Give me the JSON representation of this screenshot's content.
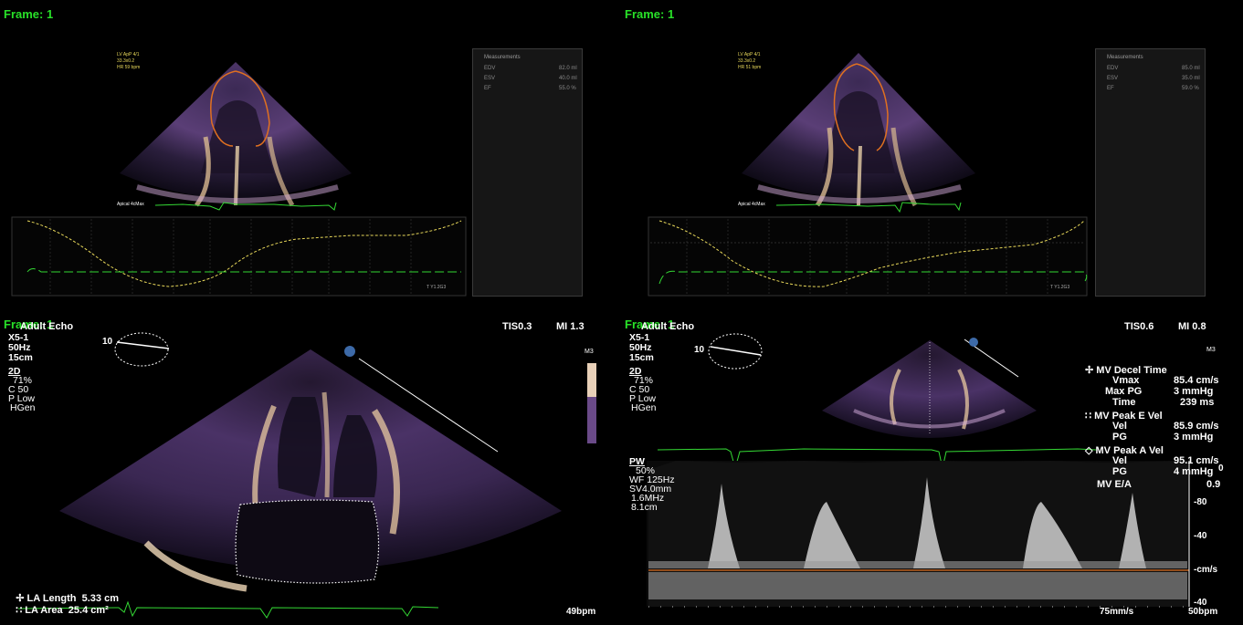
{
  "panels": {
    "top_left": {
      "frame_label": "Frame: 1",
      "overlay_lines": [
        "LV ApP 4/1",
        "33.3x0.2",
        "HR 59 bpm"
      ],
      "view_label": "Apical 4cMax",
      "measurements": {
        "title": "Measurements",
        "rows": [
          {
            "label": "EDV",
            "value": "82.0 ml"
          },
          {
            "label": "ESV",
            "value": "40.0 ml"
          },
          {
            "label": "EF",
            "value": "55.0 %"
          }
        ]
      },
      "curve_end_label": "T Y1.2G3"
    },
    "top_right": {
      "frame_label": "Frame: 1",
      "overlay_lines": [
        "LV ApP 4/1",
        "33.3x0.2",
        "HR 51 bpm"
      ],
      "view_label": "Apical 4cMax",
      "measurements": {
        "title": "Measurements",
        "rows": [
          {
            "label": "EDV",
            "value": "85.0 ml"
          },
          {
            "label": "ESV",
            "value": "35.0 ml"
          },
          {
            "label": "EF",
            "value": "59.0 %"
          }
        ]
      },
      "curve_end_label": "T Y1.2G3"
    },
    "bottom_left": {
      "frame_label": "Frame: 1",
      "mode_label": "Adult Echo",
      "tis": "TIS0.3",
      "mi": "MI 1.3",
      "params": [
        "X5-1",
        "50Hz",
        "15cm"
      ],
      "mode2d": [
        "2D",
        "71%",
        "C 50",
        "P Low",
        "HGen"
      ],
      "map_label": "M3",
      "orientation_num": "10",
      "measure_lines": [
        {
          "label": "LA Length",
          "value": "5.33 cm"
        },
        {
          "label": "LA Area",
          "value": "25.4 cm²"
        }
      ],
      "heart_rate": "49bpm"
    },
    "bottom_right": {
      "frame_label": "Frame: 1",
      "mode_label": "Adult Echo",
      "tis": "TIS0.6",
      "mi": "MI 0.8",
      "params": [
        "X5-1",
        "50Hz",
        "15cm"
      ],
      "mode2d": [
        "2D",
        "71%",
        "C 50",
        "P Low",
        "HGen"
      ],
      "map_label": "M3",
      "orientation_num": "10",
      "pw_params": [
        "PW",
        "50%",
        "WF 125Hz",
        "SV4.0mm",
        "1.6MHz",
        "8.1cm"
      ],
      "mv_results": [
        {
          "label": "MV Decel Time",
          "value": ""
        },
        {
          "label": "Vmax",
          "value": "85.4 cm/s"
        },
        {
          "label": "Max PG",
          "value": "3 mmHg"
        },
        {
          "label": "Time",
          "value": "239 ms"
        },
        {
          "label": "MV Peak E Vel",
          "value": ""
        },
        {
          "label": "Vel",
          "value": "85.9 cm/s"
        },
        {
          "label": "PG",
          "value": "3 mmHg"
        },
        {
          "label": "MV Peak A Vel",
          "value": ""
        },
        {
          "label": "Vel",
          "value": "95.1 cm/s"
        },
        {
          "label": "PG",
          "value": "4 mmHg"
        },
        {
          "label": "MV E/A",
          "value": "0.9"
        }
      ],
      "scale_labels": [
        "0",
        "-80",
        "-40",
        "-cm/s",
        "-40"
      ],
      "sweep_speed": "75mm/s",
      "heart_rate": "50bpm"
    }
  },
  "colors": {
    "frame_label": "#28e028",
    "ecg": "#34d834",
    "lv_trace": "#e07020",
    "volume_curve": "#e8d85a",
    "baseline": "#e07020"
  }
}
